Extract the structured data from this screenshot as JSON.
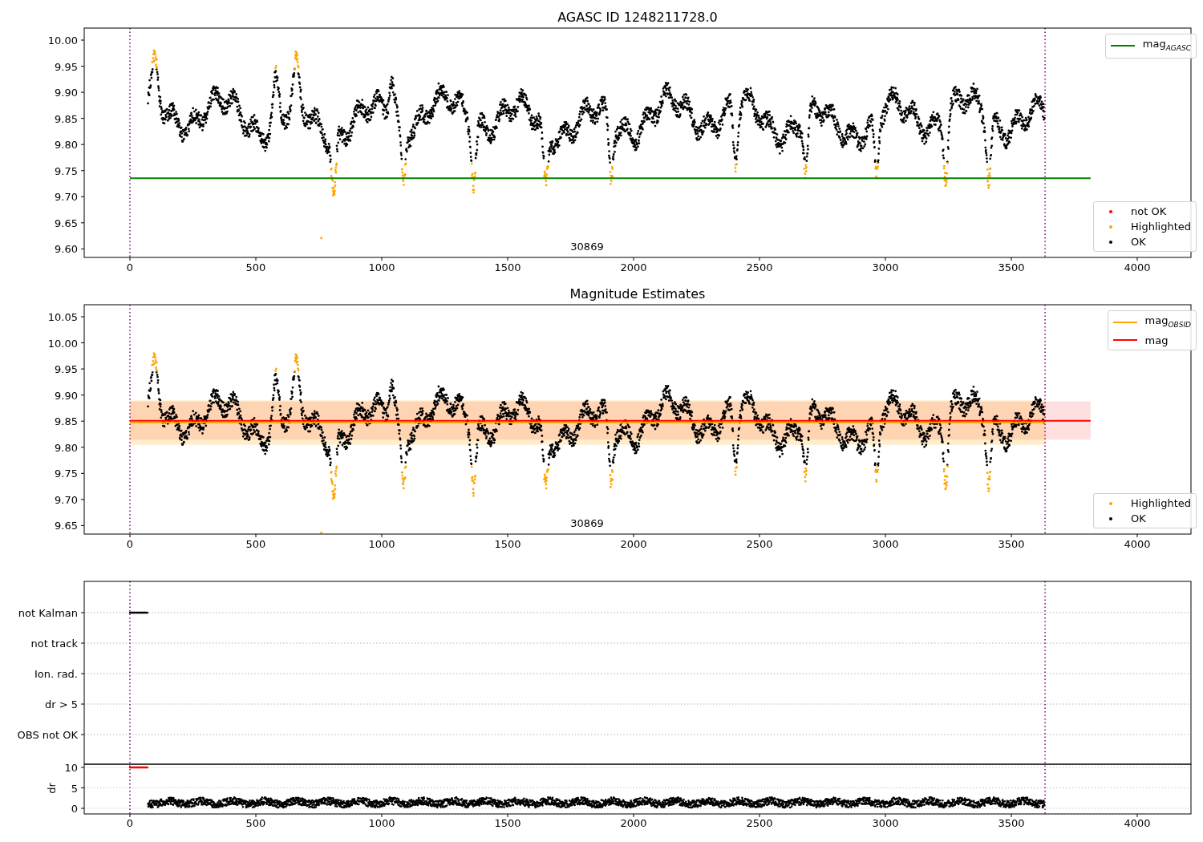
{
  "panels": [
    {
      "kind": "mag_agasc",
      "title": "AGASC ID 1248211728.0",
      "y_tick_labels": [
        "10.00",
        "9.95",
        "9.90",
        "9.85",
        "9.80",
        "9.75",
        "9.70",
        "9.65",
        "9.60"
      ],
      "x_tick_labels": [
        "0",
        "500",
        "1000",
        "1500",
        "2000",
        "2500",
        "3000",
        "3500",
        "4000"
      ],
      "annotation": "30869",
      "legend_lines": [
        {
          "label": "mag$_{AGASC}$",
          "color": "#008000"
        }
      ],
      "legend_markers": [
        {
          "label": "not OK",
          "color": "#ff0000"
        },
        {
          "label": "Highlighted",
          "color": "#ffa500"
        },
        {
          "label": "OK",
          "color": "#000000"
        }
      ]
    },
    {
      "kind": "mag_estimates",
      "title": "Magnitude Estimates",
      "y_tick_labels": [
        "10.05",
        "10.00",
        "9.95",
        "9.90",
        "9.85",
        "9.80",
        "9.75",
        "9.70",
        "9.65"
      ],
      "x_tick_labels": [
        "0",
        "500",
        "1000",
        "1500",
        "2000",
        "2500",
        "3000",
        "3500",
        "4000"
      ],
      "annotation": "30869",
      "legend_lines": [
        {
          "label": "mag$_{OBSID}$",
          "color": "#ffa500"
        },
        {
          "label": "mag",
          "color": "#ff0000"
        }
      ],
      "legend_markers": [
        {
          "label": "Highlighted",
          "color": "#ffa500"
        },
        {
          "label": "OK",
          "color": "#000000"
        }
      ]
    },
    {
      "kind": "flags",
      "categories": [
        "not Kalman",
        "not track",
        "Ion. rad.",
        "dr > 5",
        "OBS not OK"
      ],
      "dr_label": "dr",
      "dr_tick_labels": [
        "10",
        "5",
        "0"
      ],
      "x_tick_labels": [
        "0",
        "500",
        "1000",
        "1500",
        "2000",
        "2500",
        "3000",
        "3500",
        "4000"
      ]
    }
  ]
}
